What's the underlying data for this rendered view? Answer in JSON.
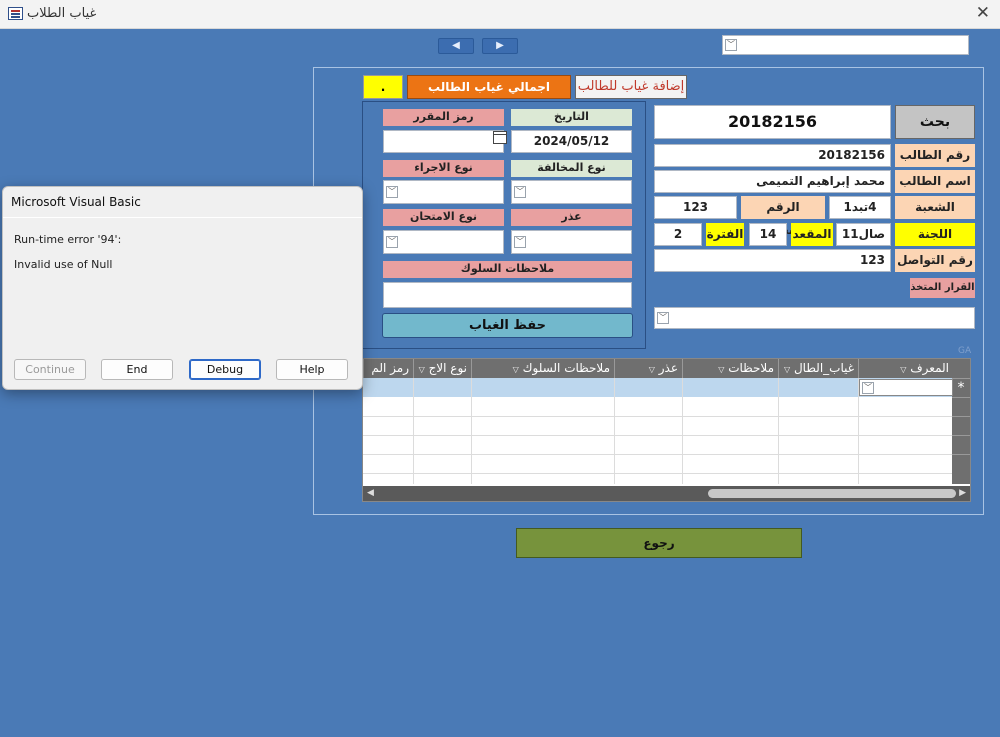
{
  "window": {
    "title": "غياب الطلاب",
    "close_glyph": "✕"
  },
  "nav": {
    "prev_glyph": "◀",
    "next_glyph": "▶"
  },
  "top_combo": {
    "value": "",
    "arrow": "﹀"
  },
  "actions": {
    "add_absence": "إضافة غياب للطالب",
    "total_absence": "اجمالي غياب الطالب",
    "count": ".",
    "search": "بحث",
    "save": "حفظ الغياب",
    "back": "رجوع"
  },
  "search_value": "20182156",
  "form": {
    "course_code_label": "رمز المقرر",
    "date_label": "التاريخ",
    "date_value": "2024/05/12",
    "procedure_type_label": "نوع الاجراء",
    "violation_type_label": "نوع المخالفة",
    "exam_type_label": "نوع الامتحان",
    "excuse_label": "عذر",
    "behavior_notes_label": "ملاحظات السلوك"
  },
  "student": {
    "id_label": "رقم الطالب",
    "id_value": "20182156",
    "name_label": "اسم الطالب",
    "name_value": "محمد إبراهيم التميمى",
    "section_label": "الشعبة",
    "section_value": "4تبد1",
    "personal_id_label": "الرقم الشخصى",
    "personal_id_value": "123",
    "committee_label": "اللجنة",
    "committee_value": "صال11",
    "seat_label": "المقعد",
    "seat_value": "14",
    "period_label": "الفترة",
    "period_value": "2",
    "contact_label": "رقم التواصل",
    "contact_value": "123",
    "decision_label": "القرار المتخذ"
  },
  "grid": {
    "columns": [
      "المعرف",
      "غياب_الطال",
      "ملاحظات",
      "عذر",
      "ملاحظات السلوك",
      "نوع الاج",
      "رمز الم"
    ],
    "sort_glyph": "▽",
    "new_row_glyph": "*",
    "corner": "GA"
  },
  "dialog": {
    "title": "Microsoft Visual Basic",
    "line1": "Run-time error '94':",
    "line2": "Invalid use of Null",
    "buttons": {
      "continue": "Continue",
      "end": "End",
      "debug": "Debug",
      "help": "Help"
    }
  }
}
